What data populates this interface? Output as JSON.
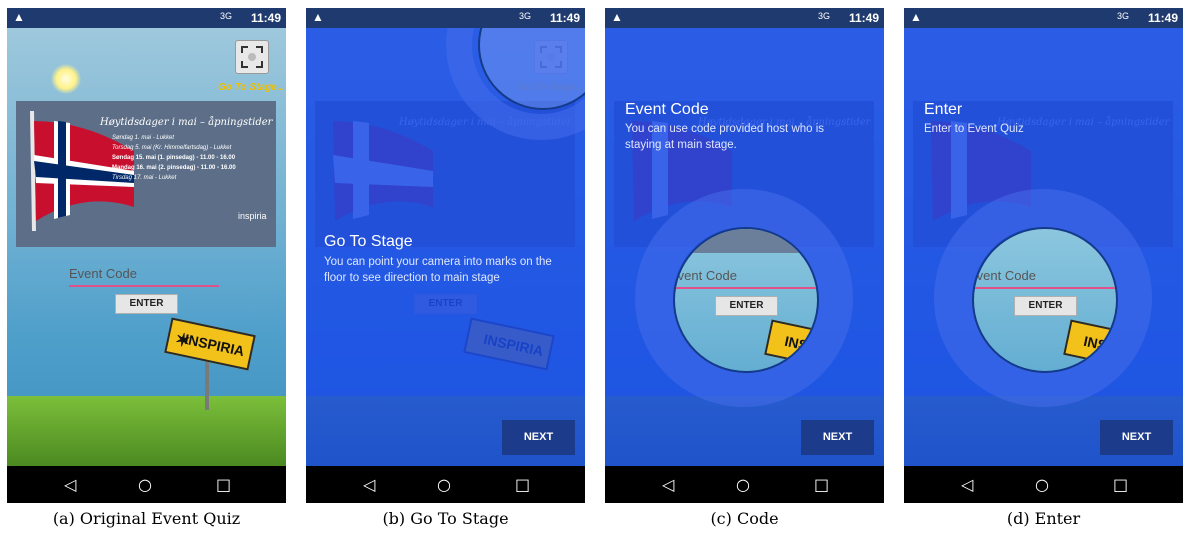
{
  "status_bar": {
    "network": "3G",
    "time": "11:49"
  },
  "scan_label": "Go To Stage...",
  "banner": {
    "title": "Høytidsdager i mai – åpningstider",
    "lines": [
      "Søndag 1. mai - Lukket",
      "Torsdag 5. mai (Kr. Himmelfartsdag) - Lukket",
      "Søndag 15. mai (1. pinsedag) - 11.00 - 16.00",
      "Mandag 16. mai (2. pinsedag) - 11.00 - 16.00",
      "Tirsdag 17. mai - Lukket"
    ],
    "logo": "inspiria"
  },
  "event_code_placeholder": "Event Code",
  "enter_label": "ENTER",
  "sign_text": "INSPIRIA",
  "next_label": "NEXT",
  "panels": [
    {
      "caption": "(a) Original Event Quiz"
    },
    {
      "caption": "(b) Go To Stage",
      "tip_title": "Go To Stage",
      "tip_desc": "You can point your camera into marks on the floor to see direction to main stage"
    },
    {
      "caption": "(c) Code",
      "tip_title": "Event Code",
      "tip_desc": "You can use code provided host who is staying at main stage."
    },
    {
      "caption": "(d) Enter",
      "tip_title": "Enter",
      "tip_desc": "Enter to Event Quiz"
    }
  ],
  "colors": {
    "overlay": "#1e4fe6",
    "next_button": "#1c3b8a",
    "scan_label": "#f0c000",
    "underline": "#e0518a"
  },
  "nav_icons": [
    "back-icon",
    "home-icon",
    "recents-icon"
  ]
}
